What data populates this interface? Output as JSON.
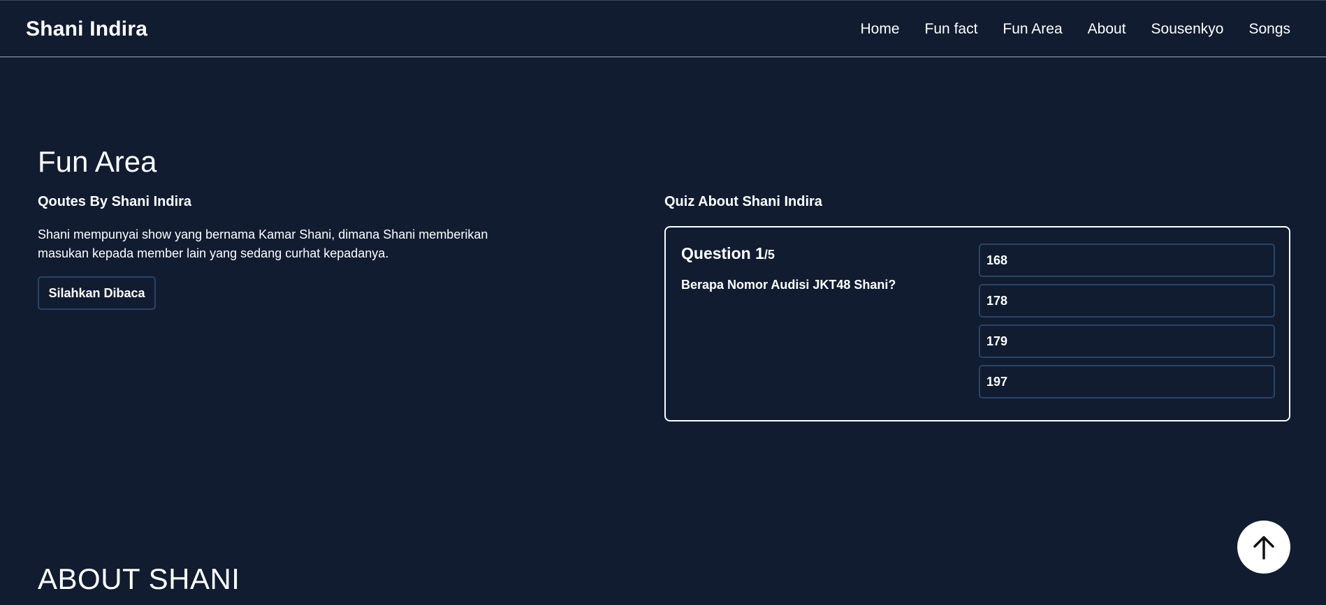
{
  "brand": "Shani Indira",
  "nav": {
    "items": [
      "Home",
      "Fun fact",
      "Fun Area",
      "About",
      "Sousenkyo",
      "Songs"
    ]
  },
  "fun_area": {
    "title": "Fun Area",
    "quotes": {
      "heading": "Qoutes By Shani Indira",
      "text": "Shani mempunyai show yang bernama Kamar Shani, dimana Shani memberikan masukan kepada member lain yang sedang curhat kepadanya.",
      "button_label": "Silahkan Dibaca"
    },
    "quiz": {
      "heading": "Quiz About Shani Indira",
      "question_label": "Question 1",
      "question_total": "/5",
      "question_text": "Berapa Nomor Audisi JKT48 Shani?",
      "options": [
        "168",
        "178",
        "179",
        "197"
      ]
    }
  },
  "about": {
    "title": "ABOUT SHANI"
  },
  "icons": {
    "scroll_top": "arrow-up-icon"
  },
  "colors": {
    "background": "#111c31",
    "text": "#ffffff",
    "button_border": "#2a4466"
  }
}
